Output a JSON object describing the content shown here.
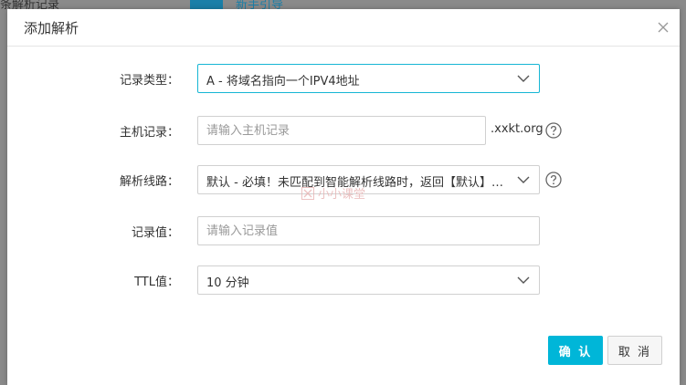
{
  "background": {
    "partial_text": "条解析记录",
    "partial_link": "新手引导"
  },
  "modal": {
    "title": "添加解析",
    "close_icon": "close-icon"
  },
  "form": {
    "record_type": {
      "label": "记录类型：",
      "value": "A - 将域名指向一个IPV4地址"
    },
    "host_record": {
      "label": "主机记录：",
      "placeholder": "请输入主机记录",
      "value": "",
      "suffix": ".xxkt.org"
    },
    "line": {
      "label": "解析线路：",
      "value": "默认 - 必填！未匹配到智能解析线路时，返回【默认】线路..."
    },
    "record_value": {
      "label": "记录值：",
      "placeholder": "请输入记录值",
      "value": ""
    },
    "ttl": {
      "label": "TTL值：",
      "value": "10 分钟"
    }
  },
  "watermark": {
    "text": "小小课堂"
  },
  "buttons": {
    "confirm": "确 认",
    "cancel": "取 消"
  },
  "colors": {
    "accent": "#00b6d8",
    "focus_border": "#16b6d4",
    "border": "#d0d0d0",
    "watermark": "#e8b4b4"
  }
}
